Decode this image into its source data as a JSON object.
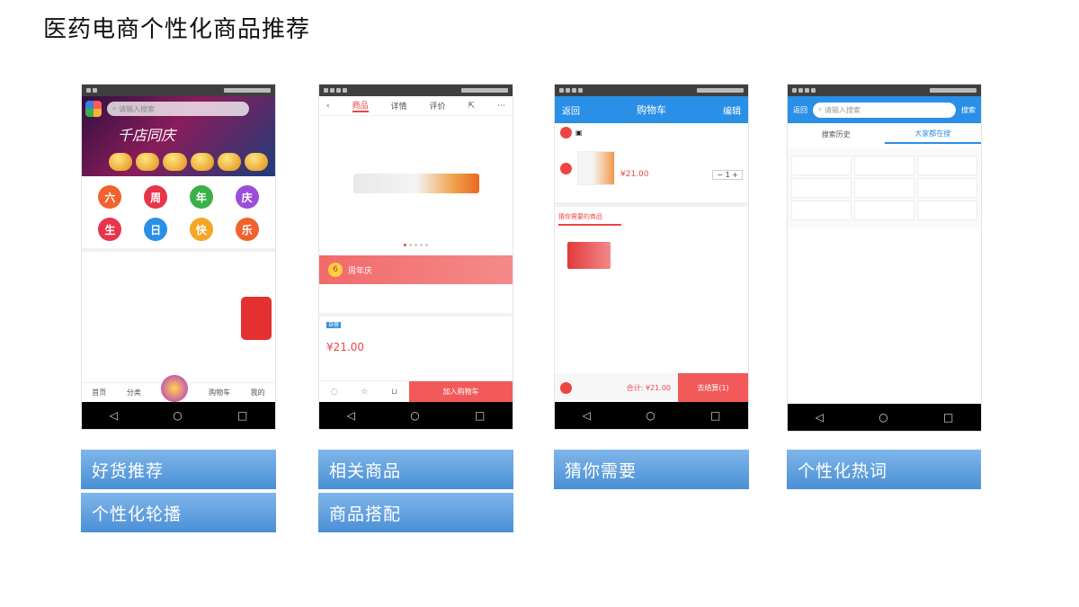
{
  "page": {
    "title": "医药电商个性化商品推荐"
  },
  "phone1": {
    "search_placeholder": "请输入搜索",
    "slogan": "千店同庆",
    "categories": [
      {
        "char": "六",
        "color": "#f2622e"
      },
      {
        "char": "周",
        "color": "#e8344a"
      },
      {
        "char": "年",
        "color": "#3bb04a"
      },
      {
        "char": "庆",
        "color": "#9b4ddb"
      },
      {
        "char": "生",
        "color": "#e8344a"
      },
      {
        "char": "日",
        "color": "#2a8fe6"
      },
      {
        "char": "快",
        "color": "#f5a623"
      },
      {
        "char": "乐",
        "color": "#f2622e"
      }
    ],
    "tabbar": [
      "首页",
      "分类",
      "购物车",
      "我的"
    ]
  },
  "phone2": {
    "tabs": [
      "商品",
      "详情",
      "评价"
    ],
    "ribbon_num": "6",
    "ribbon_text": "周年庆",
    "product_tag": "自营",
    "price": "¥21.00",
    "cta": "加入购物车"
  },
  "phone3": {
    "back": "返回",
    "title": "购物车",
    "edit": "编辑",
    "item_price": "¥21.00",
    "qty": "1",
    "guess_title": "猜你需要的商品",
    "total": "合计: ¥21.00",
    "checkout": "去结算(1)"
  },
  "phone4": {
    "back": "返回",
    "search_placeholder": "请输入搜索",
    "search_btn": "搜索",
    "tabs": [
      "搜索历史",
      "大家都在搜"
    ]
  },
  "labels": {
    "p1_top": "好货推荐",
    "p1_bottom": "个性化轮播",
    "p2_top": "相关商品",
    "p2_bottom": "商品搭配",
    "p3_top": "猜你需要",
    "p4_top": "个性化热词"
  },
  "theme": {
    "accent_blue": "#2a8fe6",
    "accent_red": "#f25a5a",
    "label_blue": "#4a8fd6"
  }
}
